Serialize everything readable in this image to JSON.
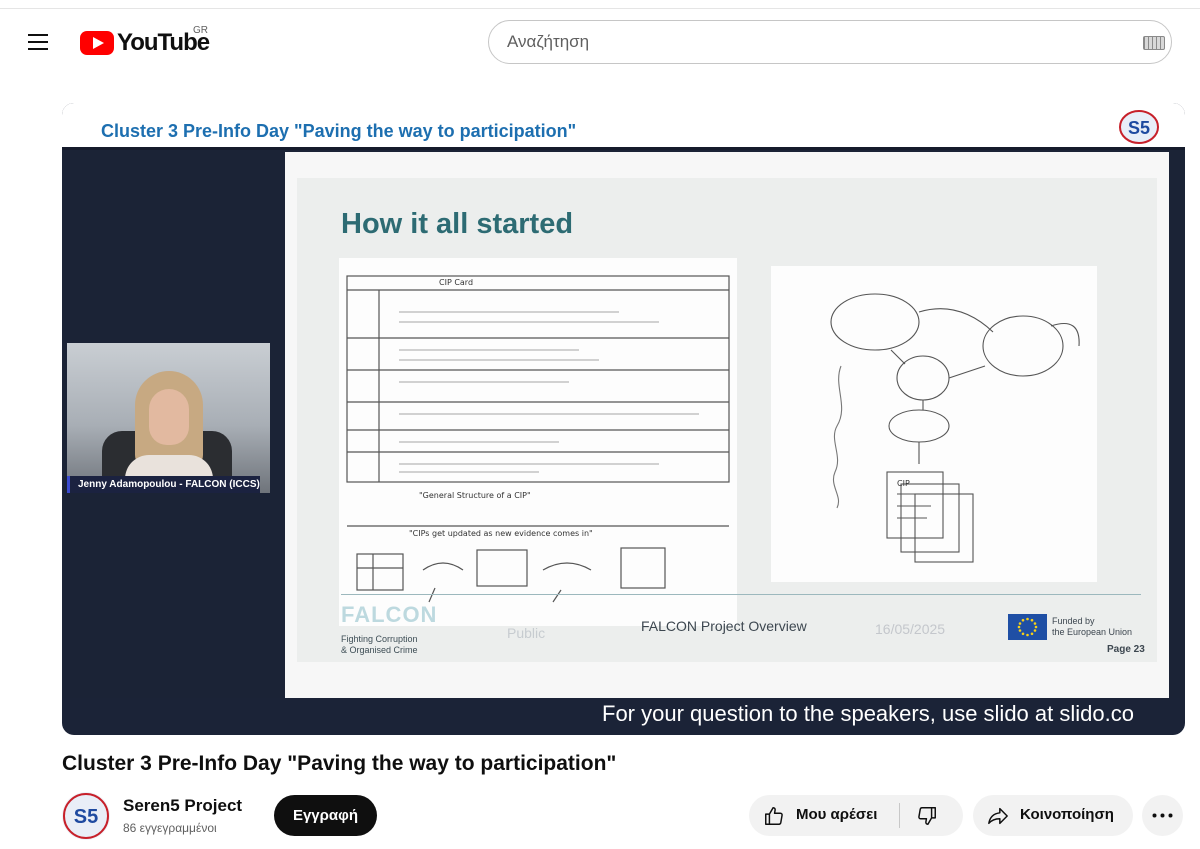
{
  "masthead": {
    "logo_text": "YouTube",
    "country_code": "GR",
    "search_placeholder": "Αναζήτηση"
  },
  "player": {
    "banner_title": "Cluster 3 Pre-Info Day \"Paving the way to participation\"",
    "banner_logo_text": "S5",
    "slide": {
      "heading": "How it all started",
      "footer_brand": "FALCON",
      "footer_brand_sub_line1": "Fighting Corruption",
      "footer_brand_sub_line2": "& Organised Crime",
      "footer_public": "Public",
      "footer_center": "FALCON Project Overview",
      "footer_date": "16/05/2025",
      "footer_funding_line1": "Funded by",
      "footer_funding_line2": "the European Union",
      "page_number": "Page 23",
      "sketch_left_title": "CIP Card",
      "sketch_left_caption": "\"General Structure of a CIP\"",
      "sketch_left_bottom_caption": "\"CIPs get updated as new evidence comes in\"",
      "sketch_right_node": "CIP"
    },
    "speaker_label": "Jenny Adamopoulou - FALCON (ICCS)",
    "ticker": "For your question to the speakers, use slido at slido.co"
  },
  "video": {
    "title": "Cluster 3 Pre-Info Day \"Paving the way to participation\"",
    "channel_name": "Seren5 Project",
    "channel_avatar_text": "S5",
    "subscribers": "86 εγγεγραμμένοι",
    "subscribe_label": "Εγγραφή",
    "like_label": "Μου αρέσει",
    "share_label": "Κοινοποίηση"
  },
  "colors": {
    "brand_red": "#ff0000",
    "banner_blue": "#1d6fb0",
    "slide_heading": "#2d6b73",
    "player_bg": "#1b2337"
  }
}
